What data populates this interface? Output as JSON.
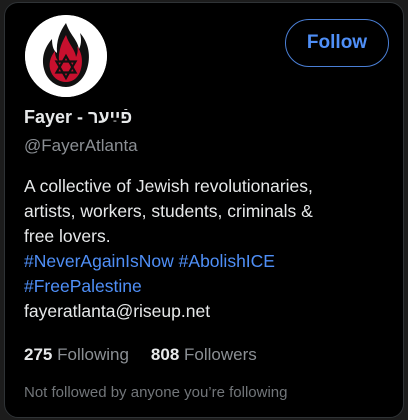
{
  "profile": {
    "display_name": "Fayer - פֿײַער",
    "handle": "@FayerAtlanta",
    "avatar_icon": "flame-star-logo-icon",
    "follow_label": "Follow",
    "bio": {
      "line1": "A collective of Jewish revolutionaries,",
      "line2": "artists, workers, students, criminals &",
      "line3": "free lovers.",
      "hashtags": [
        "#NeverAgainIsNow",
        "#AbolishICE",
        "#FreePalestine"
      ],
      "email": "fayeratlanta@riseup.net"
    },
    "following_count": "275",
    "following_label": "Following",
    "followers_count": "808",
    "followers_label": "Followers",
    "not_followed_text": "Not followed by anyone you’re following"
  },
  "colors": {
    "background": "#000000",
    "accent_blue": "#4f8ff7",
    "primary_text": "#e7e9ea",
    "secondary_text": "#8b8f94",
    "flame_red": "#c8102e"
  }
}
